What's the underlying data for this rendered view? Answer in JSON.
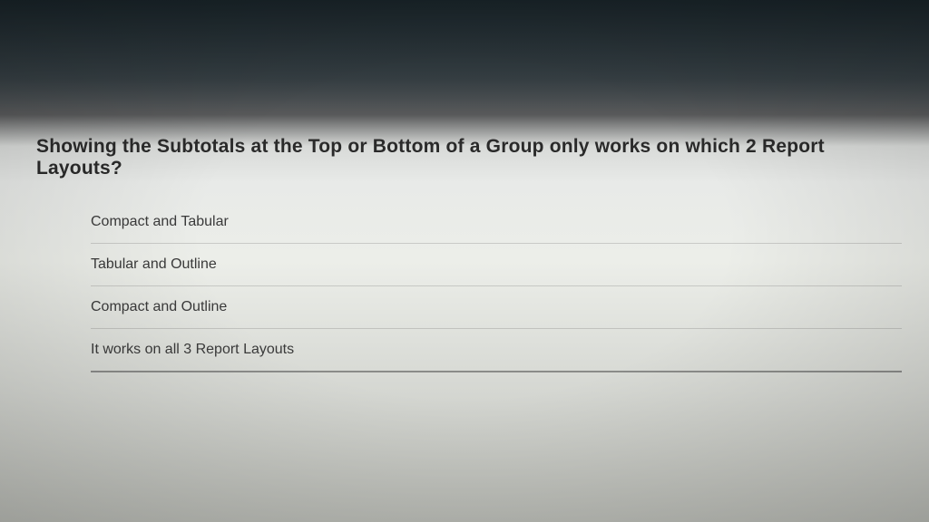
{
  "question": "Showing the Subtotals at the Top or Bottom of a Group only works on which 2 Report Layouts?",
  "options": [
    "Compact and Tabular",
    "Tabular and Outline",
    "Compact and Outline",
    "It works on all 3 Report Layouts"
  ]
}
